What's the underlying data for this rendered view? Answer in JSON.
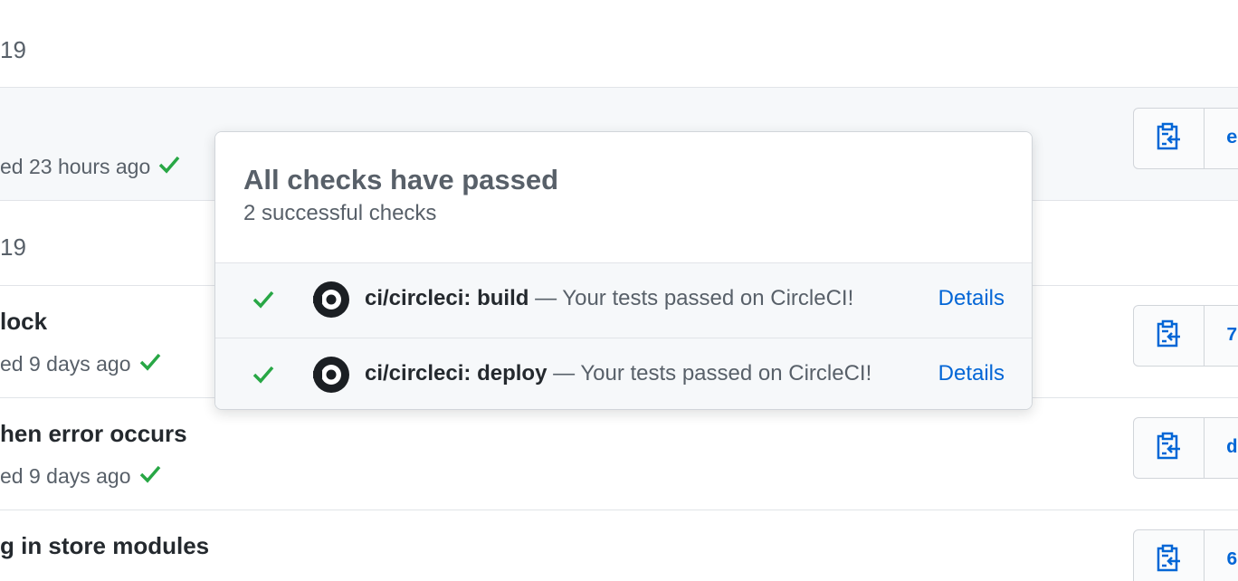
{
  "timeline": {
    "date_header_1": "19",
    "date_header_2": "19",
    "commits": [
      {
        "title": "",
        "meta": "ed 23 hours ago",
        "sha": "e"
      },
      {
        "title": "lock",
        "meta": "ed 9 days ago",
        "sha": "7"
      },
      {
        "title": "hen error occurs",
        "meta": "ed 9 days ago",
        "sha": "d"
      },
      {
        "title": "g in store modules",
        "meta": "",
        "sha": "6"
      }
    ]
  },
  "popover": {
    "title": "All checks have passed",
    "subtitle": "2 successful checks",
    "checks": [
      {
        "name": "ci/circleci: build",
        "description": " — Your tests passed on CircleCI!",
        "details_label": "Details"
      },
      {
        "name": "ci/circleci: deploy",
        "description": " — Your tests passed on CircleCI!",
        "details_label": "Details"
      }
    ]
  },
  "colors": {
    "success": "#28a745",
    "link": "#0366d6",
    "muted": "#586069"
  },
  "icons": {
    "status": "check-icon",
    "copy": "clippy-icon",
    "ci": "circleci-logo-icon"
  }
}
